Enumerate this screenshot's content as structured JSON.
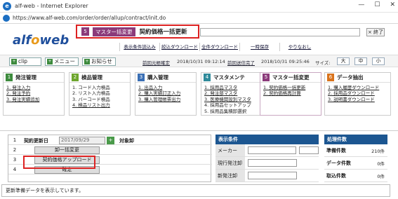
{
  "window": {
    "title": "alf-web - Internet Explorer",
    "url": "https://www.alf-web.com/order/order/allup/contract/init.do",
    "icon": "ie-icon"
  },
  "logo": {
    "main": "alf",
    "mid": "o",
    "tail": "web"
  },
  "crumb": {
    "num": "5",
    "section": "マスター括変更",
    "page": "契約価格一括更新"
  },
  "end_button": "× 終了",
  "links": [
    "表示条件読込み",
    "絞込ダウンロード",
    "全件ダウンロード",
    "一時保存",
    "やりなおし"
  ],
  "nav": {
    "clip": "clip",
    "menu": "メニュー",
    "notice": "お知らせ",
    "link1": "前回元帳確定",
    "time1": "2018/10/31 09:12:14",
    "link2": "前回送信完了",
    "time2": "2018/10/31 09:25:46",
    "size_label": "サイズ:",
    "sizes": [
      "大",
      "中",
      "小"
    ]
  },
  "panels": [
    {
      "num": "1",
      "title": "発注管理",
      "color": "#3d8b3d",
      "items": [
        "1. 発注入力",
        "2. 発注予約",
        "3. 発注実績追加"
      ]
    },
    {
      "num": "2",
      "title": "検品管理",
      "color": "#6ea62e",
      "items": [
        "1. コード入力検品",
        "2. リスト入力検品",
        "3. バーコード検品",
        "4. 検品リスト出力"
      ]
    },
    {
      "num": "3",
      "title": "購入管理",
      "color": "#3a6fb5",
      "items": [
        "1. 出品入力",
        "2. 購入実績訂正入力",
        "3. 購入管理帳票出力"
      ]
    },
    {
      "num": "4",
      "title": "マスタメンテ",
      "color": "#2f8a9a",
      "items": [
        "1. 採用品マスタ",
        "2. 発注部マスタ",
        "3. 医療機関設別マスタ",
        "4. 採用品セットアップ",
        "5. 採用品集積卸選択"
      ]
    },
    {
      "num": "5",
      "title": "マスター括変更",
      "color": "#8b3a7a",
      "items": [
        "1. 契約価格一括更新",
        "2. 契約価格再計算"
      ]
    },
    {
      "num": "6",
      "title": "データ抽出",
      "color": "#d9731c",
      "items": [
        "1. 購入履歴ダウンロード",
        "2. 採用品ダウンロード",
        "3. 説明書ダウンロード"
      ]
    }
  ],
  "left_table": {
    "label": "契約更新日",
    "date": "2017/09/29",
    "target_label": "対象卸",
    "rows": [
      "1",
      "2",
      "3",
      "4"
    ],
    "buttons": [
      "卸一括変更",
      "契約価格アップロード",
      "確定"
    ]
  },
  "filter": {
    "title": "表示条件",
    "rows": [
      "メーカー",
      "現行発注卸",
      "新発注卸"
    ]
  },
  "counts": {
    "title": "処理件数",
    "rows": [
      {
        "label": "準備件数",
        "value": "210件"
      },
      {
        "label": "データ件数",
        "value": "0件"
      },
      {
        "label": "取込件数",
        "value": "0件"
      }
    ]
  },
  "status": "更新準備データを表示しています。"
}
